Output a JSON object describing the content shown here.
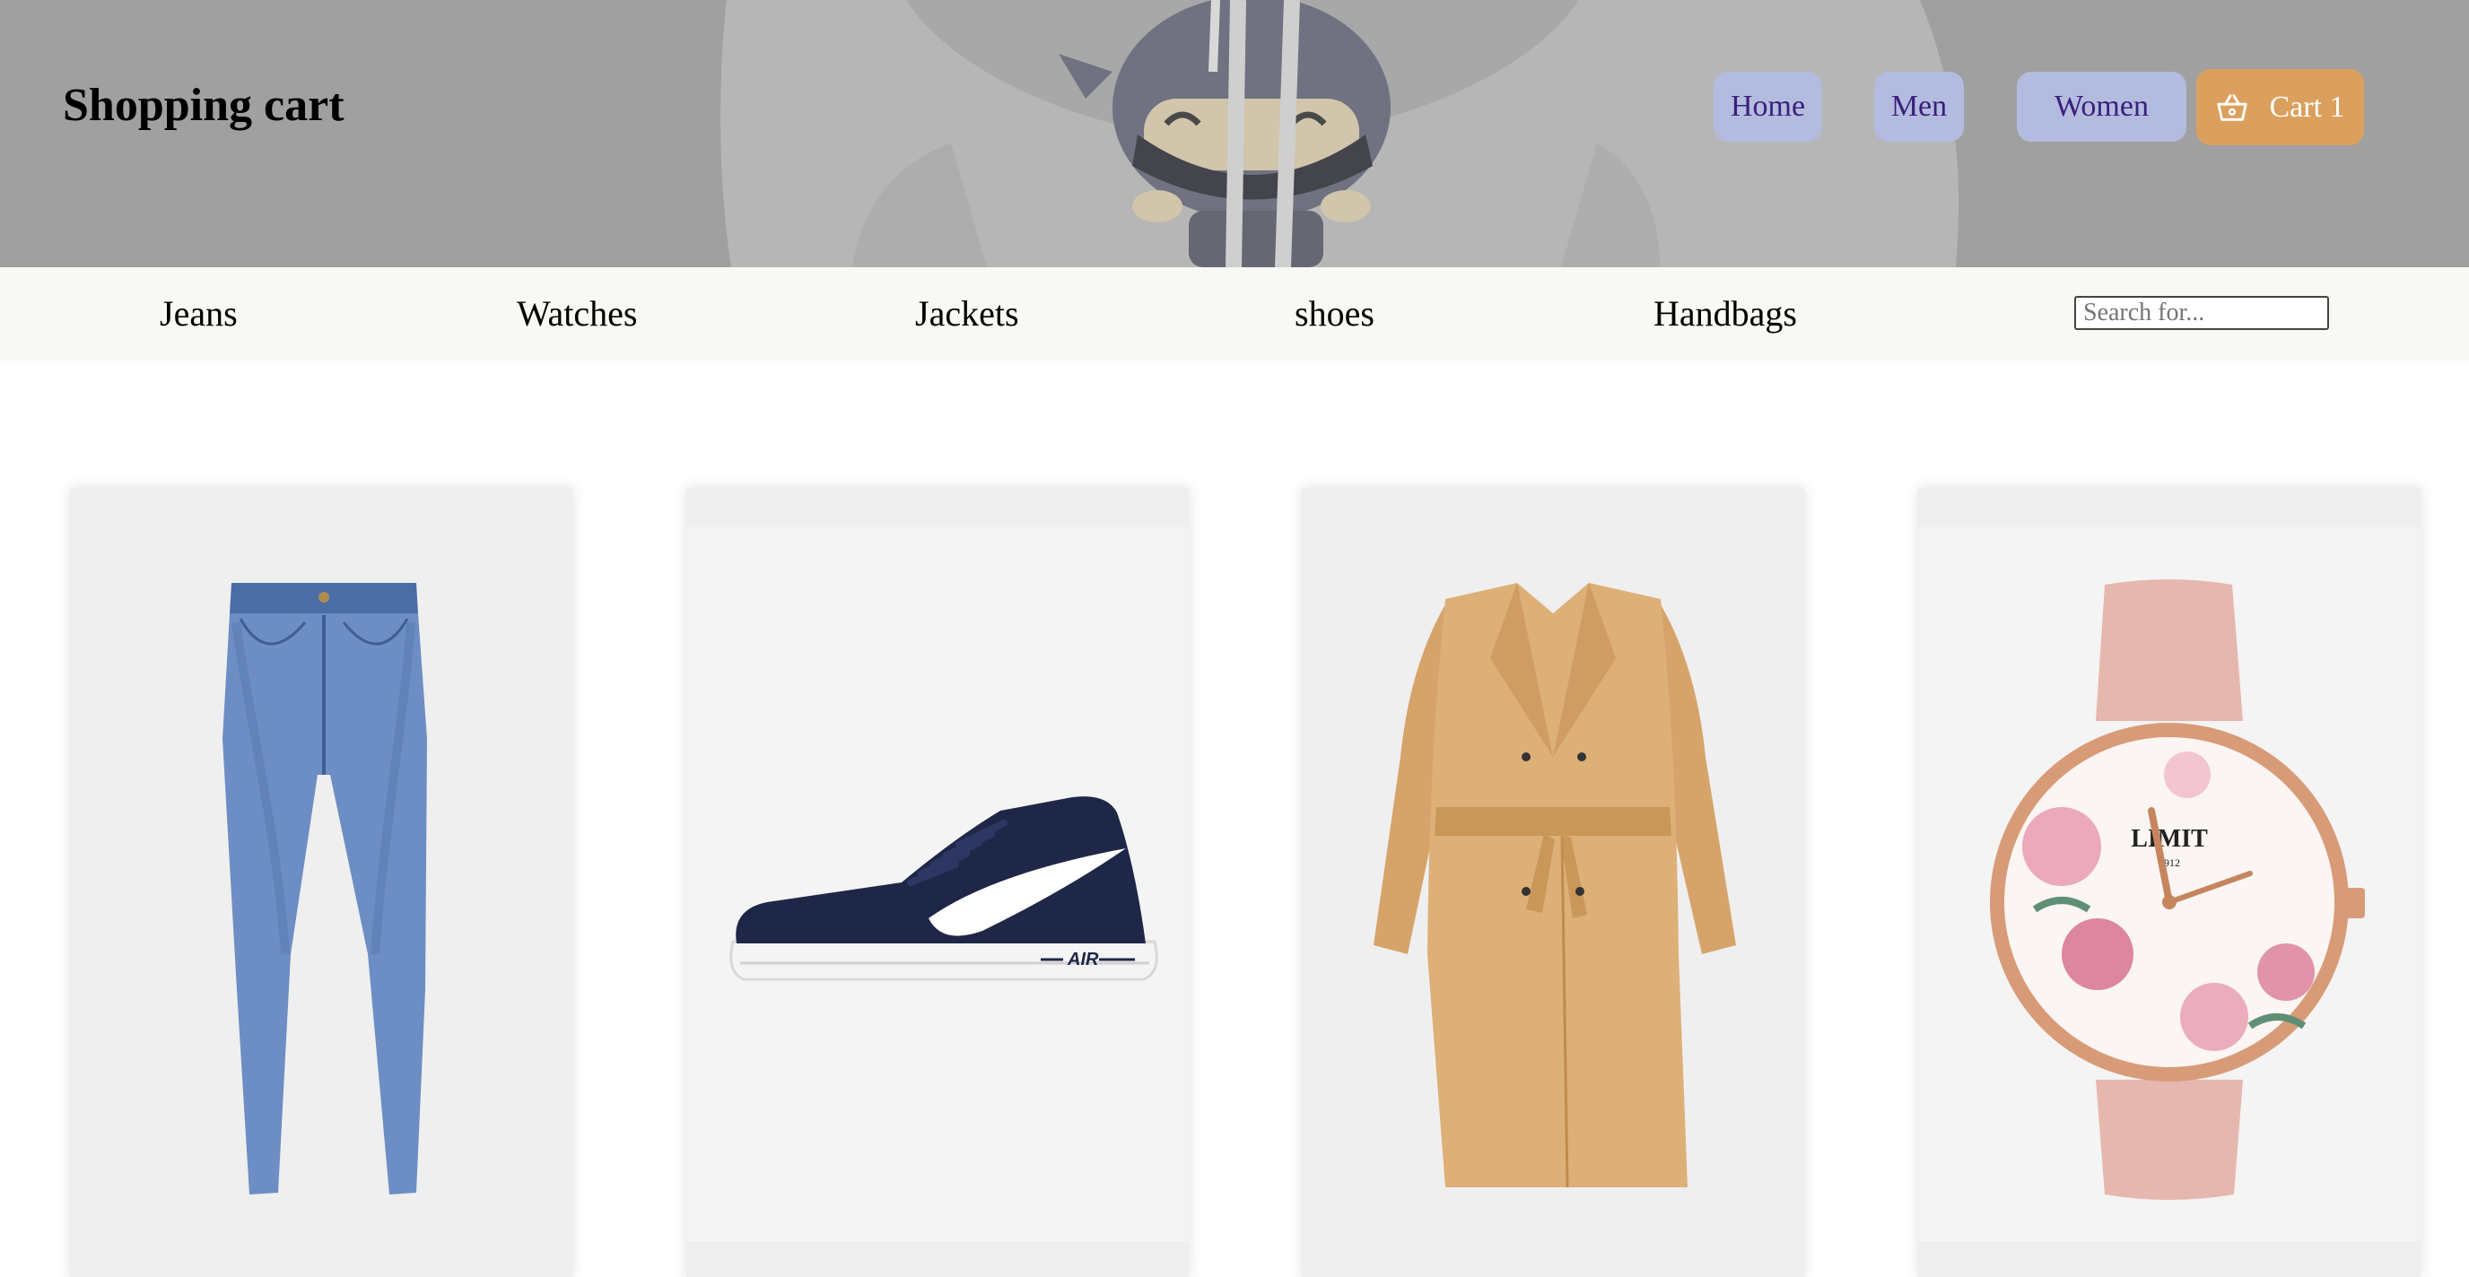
{
  "header": {
    "title": "Shopping cart",
    "nav": [
      "Home",
      "Men",
      "Women"
    ],
    "cart_label": "Cart 1",
    "cart_icon": "basket-icon"
  },
  "categories": [
    "Jeans",
    "Watches",
    "Jackets",
    "shoes",
    "Handbags"
  ],
  "search": {
    "placeholder": "Search for...",
    "value": ""
  },
  "products": [
    {
      "image": "blue-jeans"
    },
    {
      "image": "navy-sneaker"
    },
    {
      "image": "tan-trench-coat"
    },
    {
      "image": "rose-gold-watch"
    }
  ],
  "colors": {
    "header_bg": "#a7a7a7",
    "nav_button_bg": "#b3bcdf",
    "nav_button_text": "#3b1f7c",
    "cart_button_bg": "#dba05d",
    "category_bar_bg": "#f8f8f4"
  }
}
